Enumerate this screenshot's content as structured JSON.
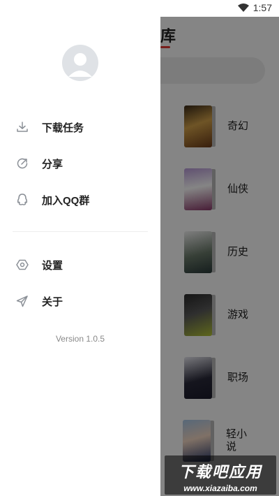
{
  "status_bar": {
    "time": "1:57",
    "icons": [
      "wifi-icon",
      "battery-icon"
    ]
  },
  "drawer": {
    "menu": [
      {
        "label": "下载任务",
        "icon": "download-icon"
      },
      {
        "label": "分享",
        "icon": "share-icon"
      },
      {
        "label": "加入QQ群",
        "icon": "qq-icon"
      },
      {
        "label": "设置",
        "icon": "settings-icon"
      },
      {
        "label": "关于",
        "icon": "send-icon"
      }
    ],
    "version": "Version 1.0.5"
  },
  "background": {
    "title": "库",
    "categories": [
      {
        "label": "奇幻"
      },
      {
        "label": "仙侠"
      },
      {
        "label": "历史"
      },
      {
        "label": "游戏"
      },
      {
        "label": "职场"
      },
      {
        "label": "轻小说"
      }
    ]
  },
  "watermark": {
    "title": "下载吧应用",
    "url": "www.xiazaiba.com"
  },
  "colors": {
    "accent": "#e53935",
    "scrim": "rgba(0,0,0,0.48)",
    "text": "#222222",
    "muted": "#888888"
  }
}
